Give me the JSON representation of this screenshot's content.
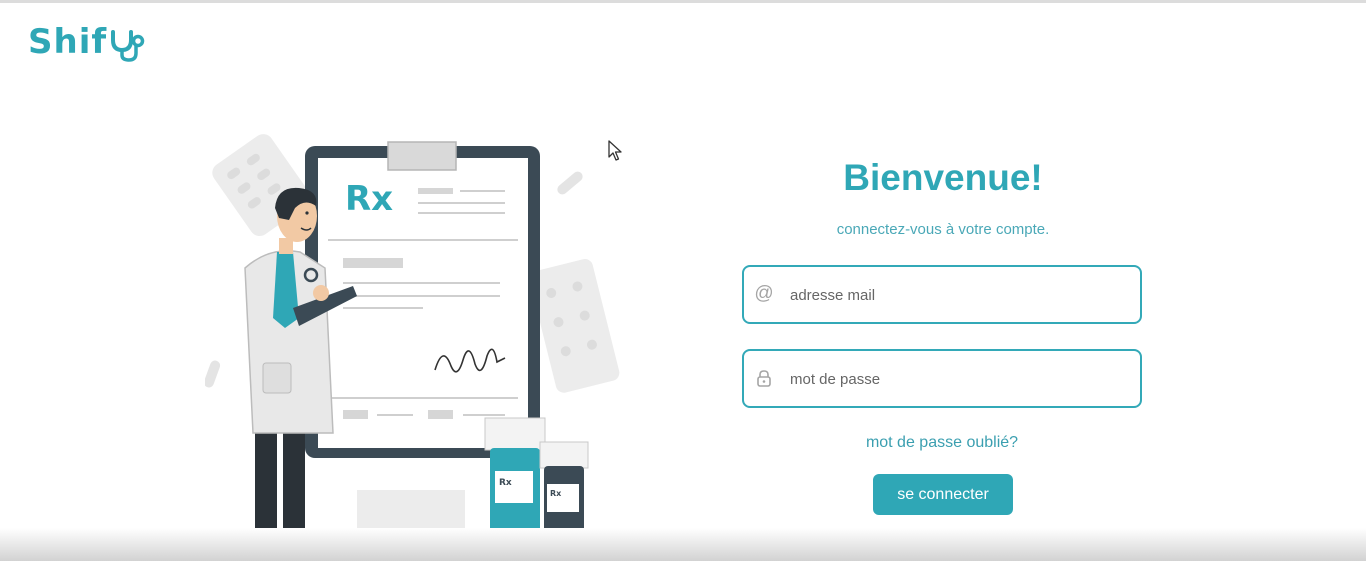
{
  "brand": {
    "name": "Shif",
    "accent_color": "#2fa7b6",
    "logo_icon": "stethoscope-icon"
  },
  "illustration": {
    "rx_label": "Rx",
    "icon": "doctor-prescription-illustration"
  },
  "login": {
    "title": "Bienvenue!",
    "subtitle": "connectez-vous à votre compte.",
    "email": {
      "placeholder": "adresse mail",
      "value": "",
      "icon": "at-sign-icon"
    },
    "password": {
      "placeholder": "mot de passe",
      "value": "",
      "icon": "lock-icon"
    },
    "forgot_label": "mot de passe oublié?",
    "submit_label": "se connecter"
  }
}
